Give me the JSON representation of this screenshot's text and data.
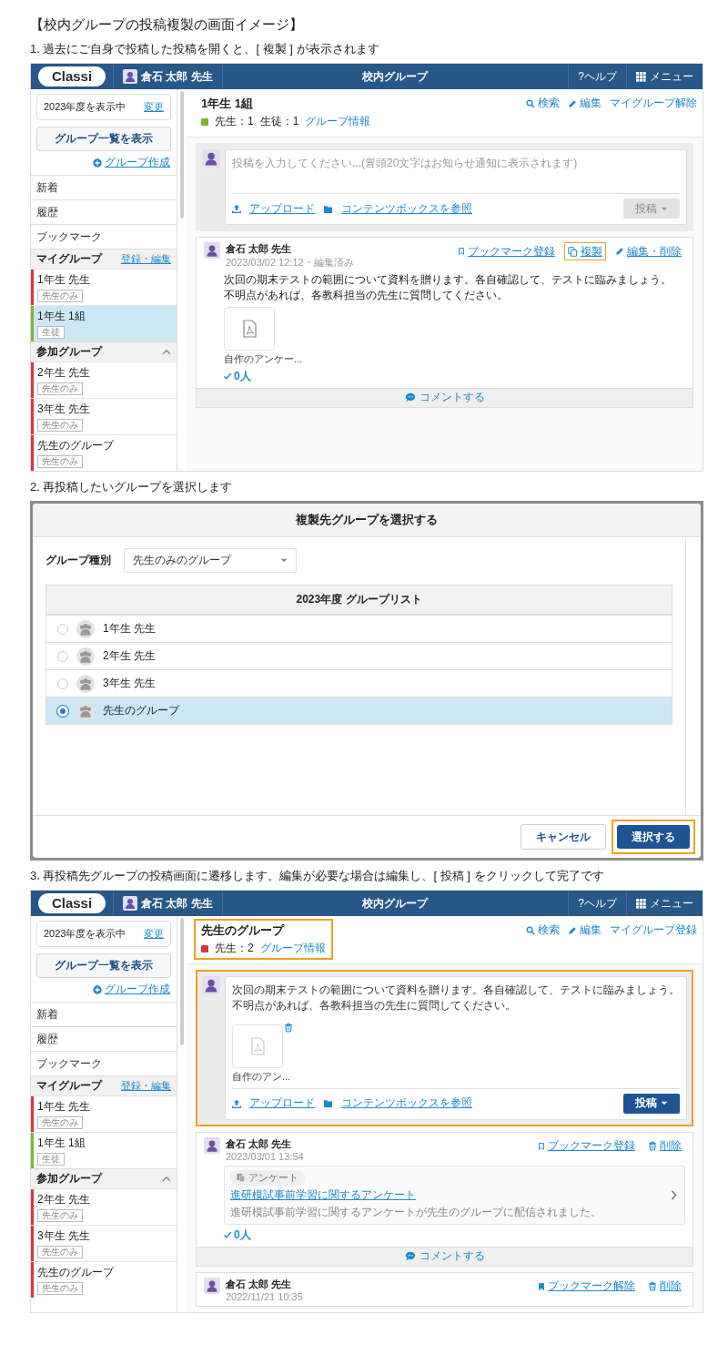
{
  "title": "【校内グループの投稿複製の画面イメージ】",
  "steps": [
    {
      "kind": "app",
      "caption": "1. 過去にご自身で投稿した投稿を開くと、[ 複製 ] が表示されます",
      "app": {
        "header": {
          "logo": "Classi",
          "user": "倉石 太郎 先生",
          "title": "校内グループ",
          "help": "?ヘルプ",
          "menu": "メニュー"
        },
        "sidebar": {
          "year": "2023年度を表示中",
          "change": "変更",
          "list_button": "グループ一覧を表示",
          "create": "グループ作成",
          "nav": [
            "新着",
            "履歴",
            "ブックマーク"
          ],
          "sections": [
            {
              "title": "マイグループ",
              "action": "登録・編集",
              "groups": [
                {
                  "name": "1年生 先生",
                  "tag": "先生のみ",
                  "color": "#d9343c",
                  "selected": false
                },
                {
                  "name": "1年生 1組",
                  "tag": "生徒",
                  "color": "#7cb82f",
                  "selected": true
                }
              ]
            },
            {
              "title": "参加グループ",
              "collapsible": true,
              "groups": [
                {
                  "name": "2年生 先生",
                  "tag": "先生のみ",
                  "color": "#d9343c",
                  "selected": false
                },
                {
                  "name": "3年生 先生",
                  "tag": "先生のみ",
                  "color": "#d9343c",
                  "selected": false
                },
                {
                  "name": "先生のグループ",
                  "tag": "先生のみ",
                  "color": "#d9343c",
                  "selected": false
                }
              ]
            }
          ]
        },
        "group": {
          "name": "1年生 1組",
          "color": "#7cb82f",
          "counts": [
            "先生：1",
            "生徒：1"
          ],
          "info": "グループ情報",
          "highlighted": false,
          "actions": [
            {
              "kind": "search",
              "label": "検索"
            },
            {
              "kind": "edit",
              "label": "編集"
            },
            {
              "kind": "plain",
              "label": "マイグループ解除"
            }
          ]
        },
        "composer": {
          "placeholder": "投稿を入力してください...(冒頭20文字はお知らせ通知に表示されます)",
          "upload": "アップロード",
          "contents": "コンテンツボックスを参照",
          "post_button": "投稿",
          "enabled": false,
          "highlighted": false
        },
        "posts": [
          {
            "author": "倉石 太郎 先生",
            "meta": "2023/03/02 12:12・編集済み",
            "actions": [
              {
                "kind": "bookmark",
                "label": "ブックマーク登録",
                "highlighted": false
              },
              {
                "kind": "copy",
                "label": "複製",
                "highlighted": true
              },
              {
                "kind": "edit",
                "label": "編集・削除",
                "highlighted": false
              }
            ],
            "body": [
              "次回の期末テストの範囲について資料を贈ります。各自確認して、テストに臨みましょう。",
              "不明点があれば、各教科担当の先生に質問してください。"
            ],
            "attachments": [
              {
                "name": "自作のアンケー..."
              }
            ],
            "reactions": "0人",
            "comment": "コメントする"
          }
        ]
      }
    },
    {
      "kind": "dialog",
      "caption": "2. 再投稿したいグループを選択します",
      "dialog": {
        "title": "複製先グループを選択する",
        "filter_label": "グループ種別",
        "filter_value": "先生のみのグループ",
        "list_title": "2023年度 グループリスト",
        "groups": [
          {
            "name": "1年生 先生",
            "selected": false
          },
          {
            "name": "2年生 先生",
            "selected": false
          },
          {
            "name": "3年生 先生",
            "selected": false
          },
          {
            "name": "先生のグループ",
            "selected": true
          }
        ],
        "cancel": "キャンセル",
        "confirm": "選択する",
        "confirm_highlighted": true
      }
    },
    {
      "kind": "app",
      "caption": "3. 再投稿先グループの投稿画面に遷移します。編集が必要な場合は編集し、[ 投稿 ] をクリックして完了です",
      "app": {
        "header": {
          "logo": "Classi",
          "user": "倉石 太郎 先生",
          "title": "校内グループ",
          "help": "?ヘルプ",
          "menu": "メニュー"
        },
        "sidebar": {
          "year": "2023年度を表示中",
          "change": "変更",
          "list_button": "グループ一覧を表示",
          "create": "グループ作成",
          "nav": [
            "新着",
            "履歴",
            "ブックマーク"
          ],
          "sections": [
            {
              "title": "マイグループ",
              "action": "登録・編集",
              "groups": [
                {
                  "name": "1年生 先生",
                  "tag": "先生のみ",
                  "color": "#d9343c",
                  "selected": false
                },
                {
                  "name": "1年生 1組",
                  "tag": "生徒",
                  "color": "#7cb82f",
                  "selected": false
                }
              ]
            },
            {
              "title": "参加グループ",
              "collapsible": true,
              "groups": [
                {
                  "name": "2年生 先生",
                  "tag": "先生のみ",
                  "color": "#d9343c",
                  "selected": false
                },
                {
                  "name": "3年生 先生",
                  "tag": "先生のみ",
                  "color": "#d9343c",
                  "selected": false
                },
                {
                  "name": "先生のグループ",
                  "tag": "先生のみ",
                  "color": "#d9343c",
                  "selected": false
                }
              ]
            }
          ]
        },
        "group": {
          "name": "先生のグループ",
          "color": "#d9343c",
          "counts": [
            "先生：2"
          ],
          "info": "グループ情報",
          "highlighted": true,
          "actions": [
            {
              "kind": "search",
              "label": "検索"
            },
            {
              "kind": "edit",
              "label": "編集"
            },
            {
              "kind": "plain",
              "label": "マイグループ登録"
            }
          ]
        },
        "composer": {
          "value_lines": [
            "次回の期末テストの範囲について資料を贈ります。各自確認して、テストに臨みましょう。",
            "不明点があれば、各教科担当の先生に質問してください。"
          ],
          "attachments": [
            {
              "name": "自作のアン..."
            }
          ],
          "upload": "アップロード",
          "contents": "コンテンツボックスを参照",
          "post_button": "投稿",
          "enabled": true,
          "highlighted": true
        },
        "posts": [
          {
            "author": "倉石 太郎 先生",
            "meta": "2023/03/01 13:54",
            "actions": [
              {
                "kind": "bookmark",
                "label": "ブックマーク登録",
                "highlighted": false
              },
              {
                "kind": "delete",
                "label": "削除",
                "highlighted": false
              }
            ],
            "survey": {
              "tag": "アンケート",
              "title": "進研模試事前学習に関するアンケート",
              "description": "進研模試事前学習に関するアンケートが先生のグループに配信されました。"
            },
            "reactions": "0人",
            "comment": "コメントする"
          },
          {
            "author": "倉石 太郎 先生",
            "meta": "2022/11/21 10:35",
            "actions": [
              {
                "kind": "bookmarked",
                "label": "ブックマーク解除",
                "highlighted": false
              },
              {
                "kind": "delete",
                "label": "削除",
                "highlighted": false
              }
            ]
          }
        ]
      }
    }
  ]
}
